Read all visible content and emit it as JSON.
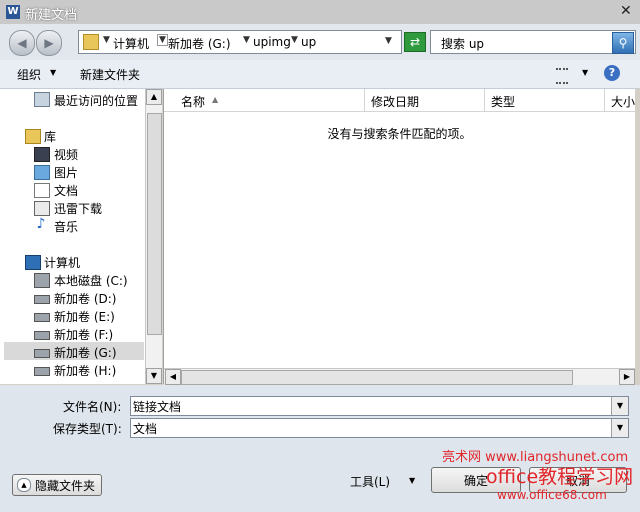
{
  "title_bar": {
    "app_icon": "W",
    "title": "新建文档",
    "close": "✕"
  },
  "nav": {
    "crumbs": [
      "计算机",
      "新加卷 (G:)",
      "upimg",
      "up"
    ],
    "search_text": "搜索 up"
  },
  "toolbar": {
    "organize": "组织",
    "new_folder": "新建文件夹",
    "help": "?"
  },
  "sidebar": {
    "recent": "最近访问的位置",
    "libraries": "库",
    "lib_items": [
      "视频",
      "图片",
      "文档",
      "迅雷下载",
      "音乐"
    ],
    "computer": "计算机",
    "drives": [
      "本地磁盘 (C:)",
      "新加卷 (D:)",
      "新加卷 (E:)",
      "新加卷 (F:)",
      "新加卷 (G:)",
      "新加卷 (H:)"
    ]
  },
  "columns": [
    "名称",
    "修改日期",
    "类型",
    "大小"
  ],
  "empty_message": "没有与搜索条件匹配的项。",
  "form": {
    "filename_label": "文件名(N):",
    "filename_value": "链接文档",
    "filetype_label": "保存类型(T):",
    "filetype_value": "文档"
  },
  "footer": {
    "hide_folders": "隐藏文件夹",
    "tools": "工具(L)",
    "confirm": "确定",
    "cancel": "取消"
  },
  "watermark": {
    "line1": "亮术网 www.liangshunet.com",
    "line2": "office教程学习网",
    "line3": "www.office68.com"
  }
}
